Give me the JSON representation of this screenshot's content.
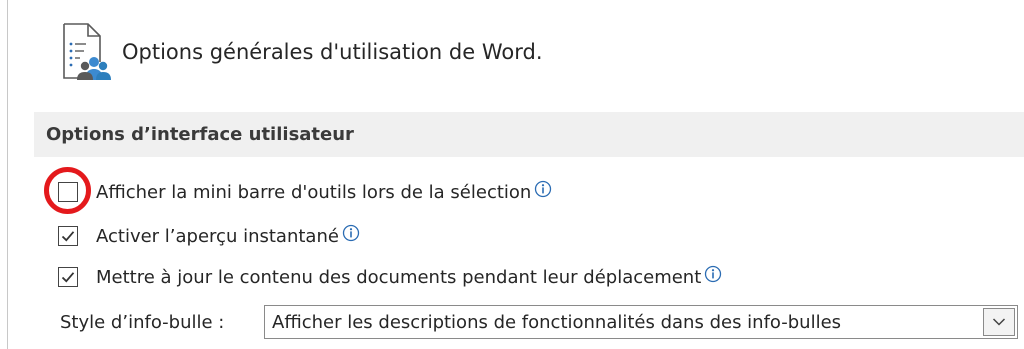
{
  "header": {
    "title": "Options générales d'utilisation de Word."
  },
  "section": {
    "title": "Options d’interface utilisateur"
  },
  "options": [
    {
      "label": "Afficher la mini barre d'outils lors de la sélection",
      "checked": false,
      "info": true,
      "highlighted": true
    },
    {
      "label": "Activer l’aperçu instantané",
      "checked": true,
      "info": true
    },
    {
      "label": "Mettre à jour le contenu des documents pendant leur déplacement",
      "checked": true,
      "info": true
    }
  ],
  "tooltip_style": {
    "label": "Style d’info-bulle :",
    "value": "Afficher les descriptions de fonctionnalités dans des info-bulles"
  },
  "colors": {
    "highlight_circle": "#e4191c",
    "info_icon": "#2b6cb3",
    "section_bg": "#f0f0f0"
  },
  "icons": {
    "header": "document-options-icon",
    "info": "info-icon",
    "dropdown": "chevron-down-icon"
  }
}
